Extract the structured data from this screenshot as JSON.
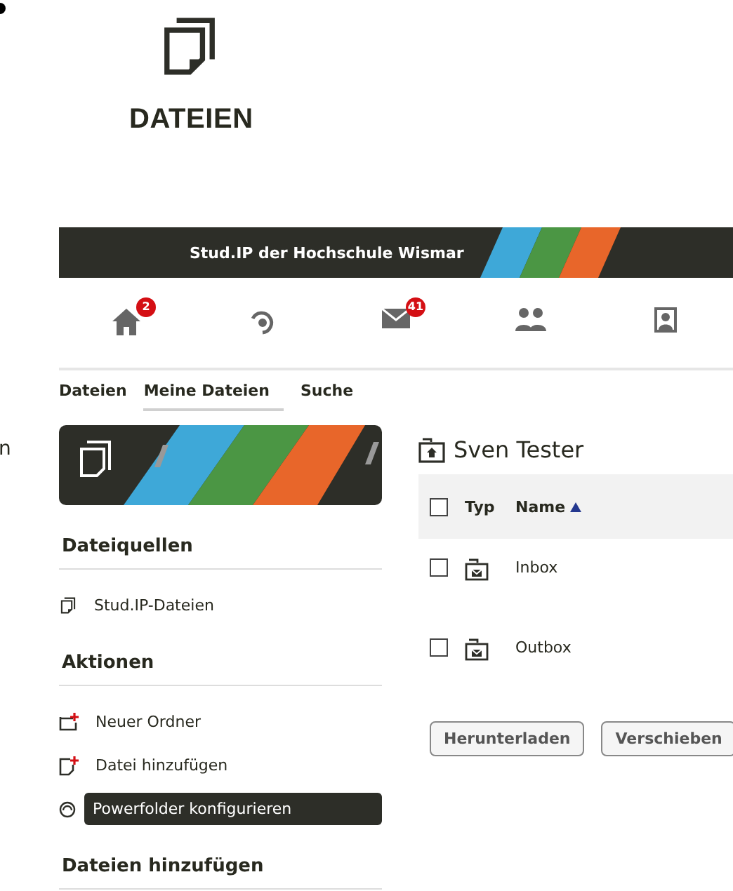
{
  "doc": {
    "heading": "DATEIEN",
    "margin_fragment": "n"
  },
  "header": {
    "title": "Stud.IP der Hochschule Wismar"
  },
  "nav": [
    {
      "kind": "home",
      "badge": "2"
    },
    {
      "kind": "activity"
    },
    {
      "kind": "mail",
      "badge": "41"
    },
    {
      "kind": "community"
    },
    {
      "kind": "profile"
    }
  ],
  "tabs": [
    {
      "label": "Dateien",
      "selected": false
    },
    {
      "label": "Meine Dateien",
      "selected": true
    },
    {
      "label": "Suche",
      "selected": false
    }
  ],
  "sidebar": {
    "sections": [
      {
        "title": "Dateiquellen",
        "items": [
          {
            "kind": "files",
            "label": "Stud.IP-Dateien",
            "selected": false
          }
        ]
      },
      {
        "title": "Aktionen",
        "items": [
          {
            "kind": "new-folder",
            "label": "Neuer Ordner",
            "selected": false
          },
          {
            "kind": "add-file",
            "label": "Datei hinzufügen",
            "selected": false
          },
          {
            "kind": "config",
            "label": "Powerfolder konfigurieren",
            "selected": true
          }
        ]
      },
      {
        "title": "Dateien hinzufügen"
      }
    ]
  },
  "folder": {
    "title": "Sven Tester"
  },
  "table": {
    "columns": [
      "Typ",
      "Name"
    ],
    "sorted_ascending": true,
    "all_checked": false,
    "rows": [
      {
        "name": "Inbox",
        "checked": false
      },
      {
        "name": "Outbox",
        "checked": false
      }
    ]
  },
  "buttons": [
    "Herunterladen",
    "Verschieben"
  ]
}
